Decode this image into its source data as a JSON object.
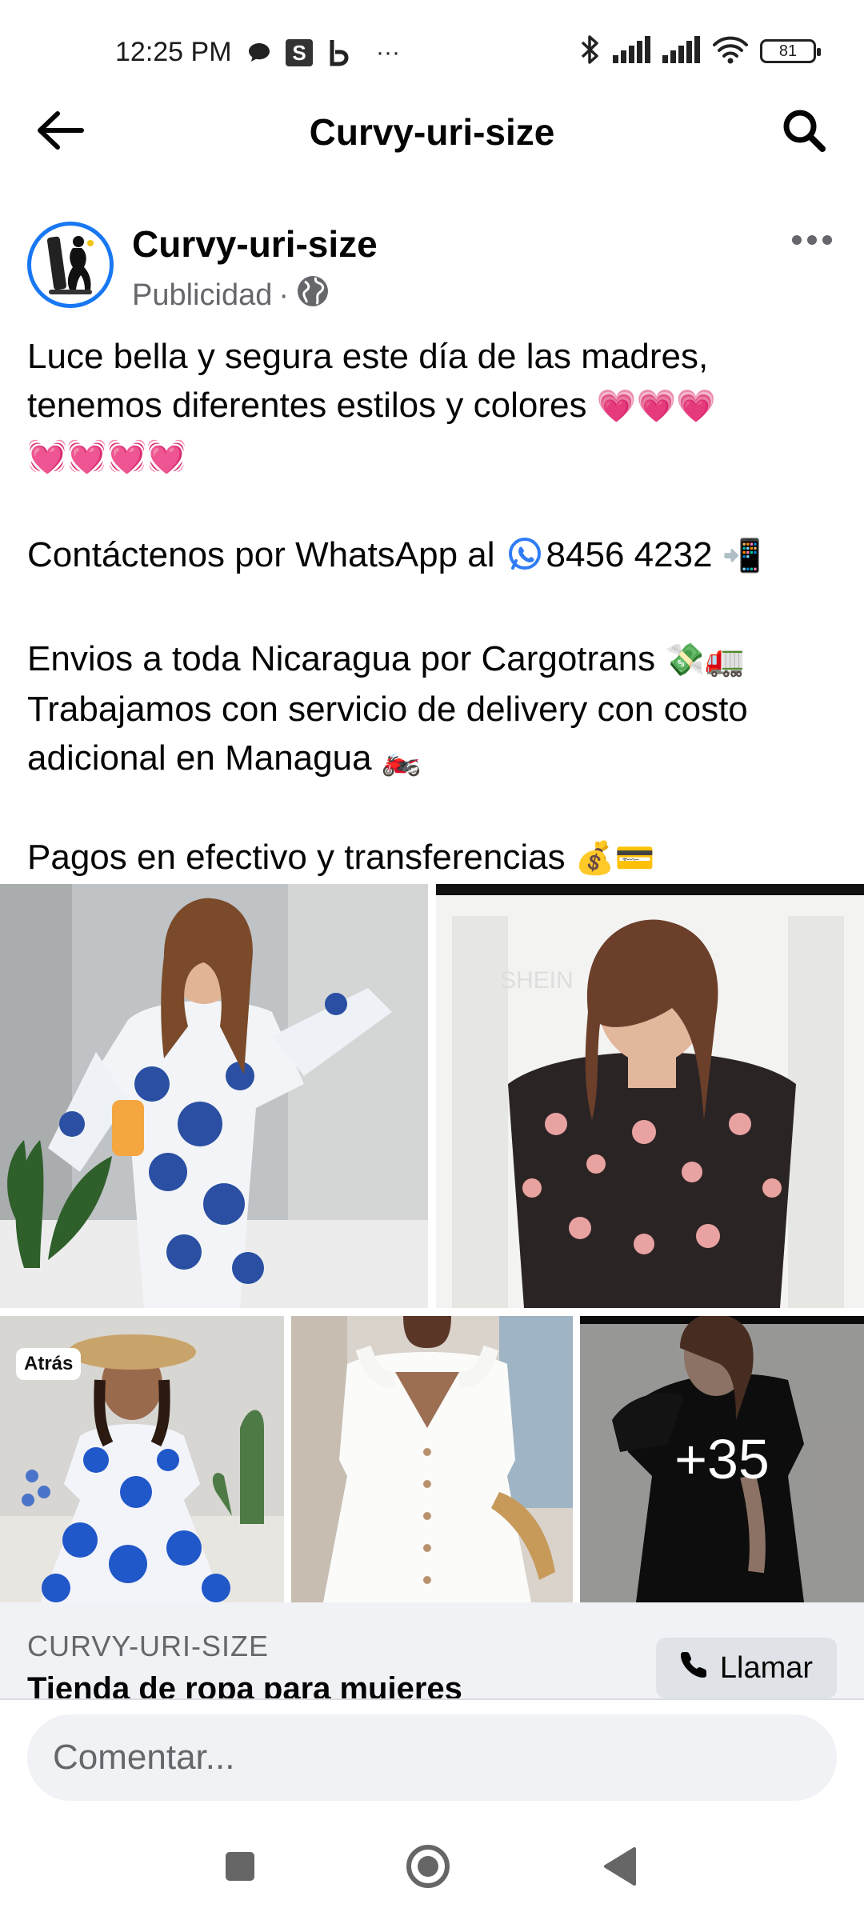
{
  "status_bar": {
    "time": "12:25 PM",
    "ellipsis": "···",
    "battery_level": "81",
    "icons": [
      "message-icon",
      "s-app-icon",
      "b-app-icon",
      "bluetooth-icon",
      "signal-icon",
      "signal-icon",
      "wifi-icon",
      "battery-icon"
    ]
  },
  "nav": {
    "title": "Curvy-uri-size",
    "icons": [
      "back-arrow-icon",
      "search-icon"
    ]
  },
  "post": {
    "page_name": "Curvy-uri-size",
    "sponsored_label": "Publicidad",
    "dot_separator": "·",
    "text_lines": {
      "l1": "Luce bella y segura este día de las madres,",
      "l2": "tenemos diferentes estilos y colores",
      "l2_emoji": "💗💗💗",
      "l3_emoji": "💓💓💓💓",
      "l4": "Contáctenos por WhatsApp al",
      "l4_phone": "8456 4232",
      "l4_emoji": "📲",
      "l5": "Envios a toda Nicaragua por Cargotrans",
      "l5_emoji": "💸🚛",
      "l6": "Trabajamos con servicio de delivery con costo",
      "l7": "adicional en Managua",
      "l7_emoji": "🏍️",
      "l8": "Pagos en efectivo y transferencias",
      "l8_emoji": "💰💳"
    }
  },
  "photos": {
    "badge": "Atrás",
    "more_count": "+35",
    "watermark": "SHEIN"
  },
  "cta": {
    "caption": "CURVY-URI-SIZE",
    "headline": "Tienda de ropa para mujeres",
    "call_label": "Llamar"
  },
  "comment": {
    "placeholder": "Comentar..."
  },
  "colors": {
    "accent": "#1877f2",
    "secondary_text": "#65676b",
    "cta_bg": "#f0f2f5",
    "whatsapp": "#2f7cf6"
  }
}
